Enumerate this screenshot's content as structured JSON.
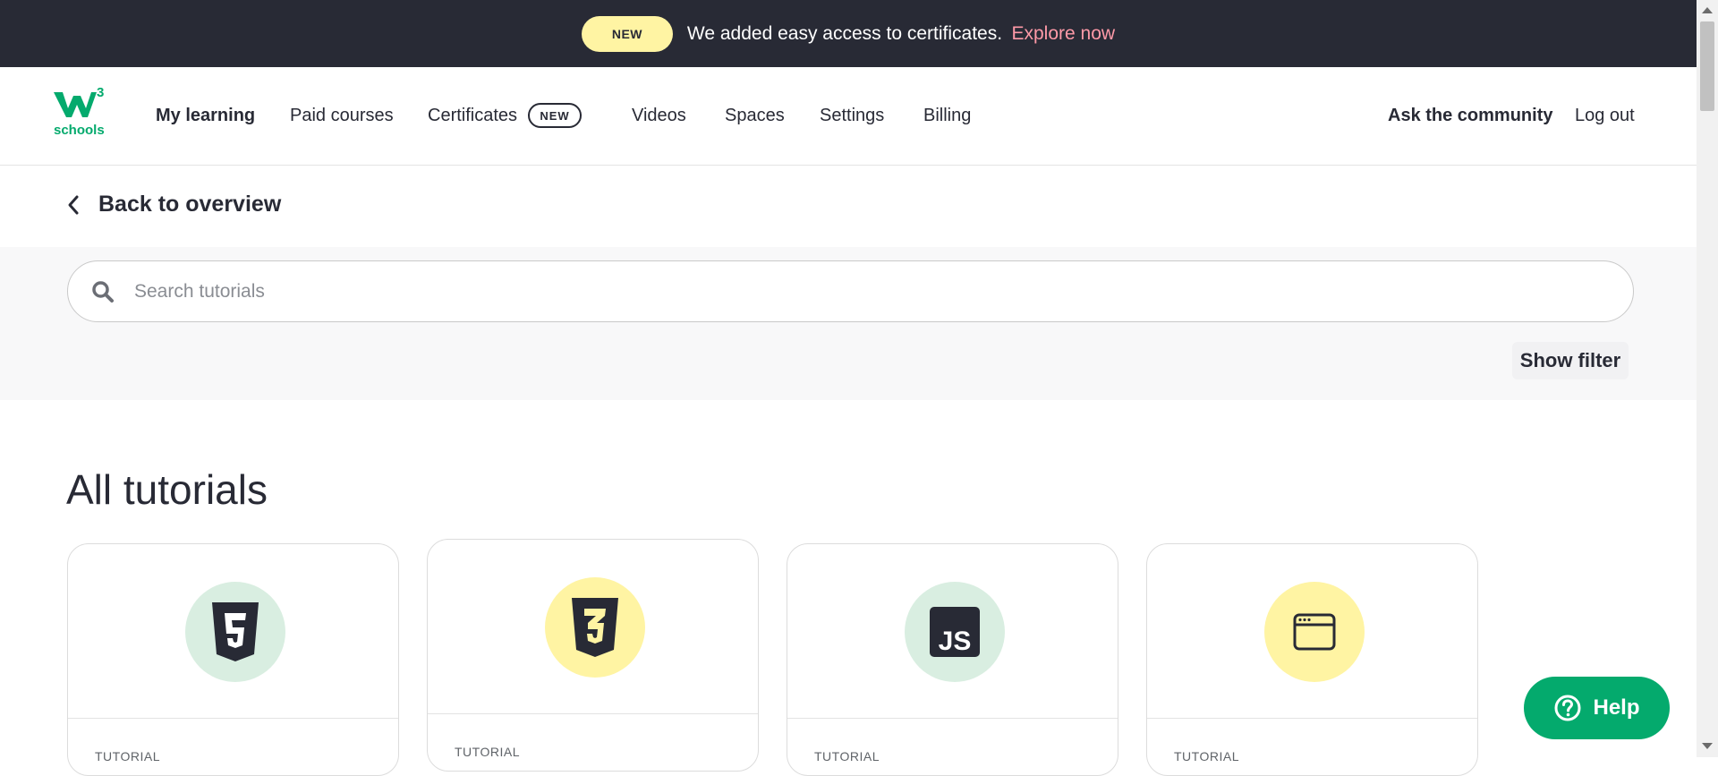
{
  "announcement": {
    "badge": "NEW",
    "message": "We added easy access to certificates.",
    "link": "Explore now"
  },
  "nav": {
    "logo_text": "schools",
    "logo_superscript": "3",
    "items": [
      {
        "label": "My learning"
      },
      {
        "label": "Paid courses"
      },
      {
        "label": "Certificates"
      },
      {
        "label": "Videos"
      },
      {
        "label": "Spaces"
      },
      {
        "label": "Settings"
      },
      {
        "label": "Billing"
      }
    ],
    "certificates_badge": "NEW",
    "ask_community": "Ask the community",
    "logout": "Log out"
  },
  "back": {
    "label": "Back to overview"
  },
  "search": {
    "placeholder": "Search tutorials"
  },
  "filter": {
    "label": "Show filter"
  },
  "heading": "All tutorials",
  "cards": [
    {
      "tag": "TUTORIAL",
      "icon": "html5-icon",
      "bg": "#d9eee1"
    },
    {
      "tag": "TUTORIAL",
      "icon": "css3-icon",
      "bg": "#fff4a3"
    },
    {
      "tag": "TUTORIAL",
      "icon": "javascript-icon",
      "bg": "#d9eee1"
    },
    {
      "tag": "TUTORIAL",
      "icon": "browser-window-icon",
      "bg": "#fff4a3"
    }
  ],
  "help": {
    "label": "Help"
  },
  "colors": {
    "brand_green": "#04aa6d",
    "dark": "#282a35",
    "yellow": "#fff4a3",
    "link_pink": "#ff9aa8"
  }
}
